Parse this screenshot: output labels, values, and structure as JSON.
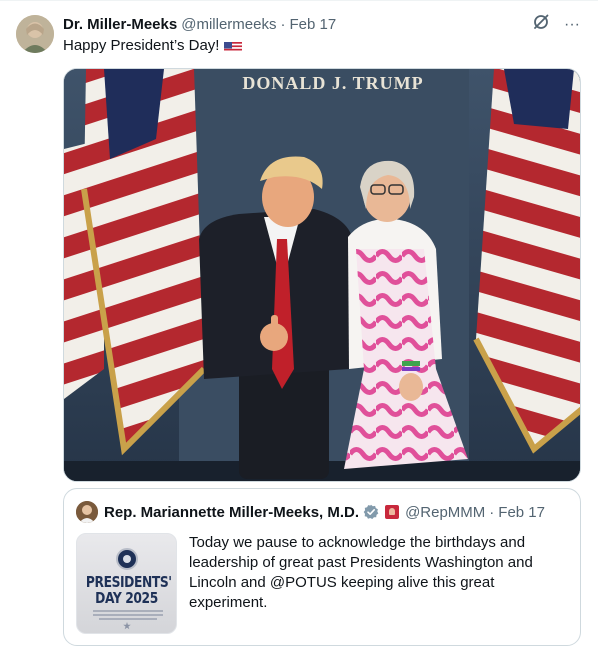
{
  "tweet": {
    "author_name": "Dr. Miller-Meeks",
    "author_handle": "@millermeeks",
    "separator": "·",
    "date": "Feb 17",
    "text": "Happy President’s Day!",
    "text_emoji": "us-flag-emoji",
    "tools": {
      "grok_icon": "grok-icon",
      "more_label": "···"
    }
  },
  "media": {
    "backdrop_text": "DONALD J. TRUMP",
    "alt": "photo",
    "colors": {
      "backdrop": "#3a4d62",
      "flag_red": "#b4282f",
      "flag_blue": "#1f2d5a",
      "flag_fringe": "#c9a14a",
      "dress_pink": "#e0509a"
    }
  },
  "quote": {
    "author_name": "Rep. Mariannette Miller-Meeks, M.D.",
    "verified_icon": "verified-gray-icon",
    "badge_icon": "government-badge-icon",
    "author_handle": "@RepMMM",
    "separator": "·",
    "date": "Feb 17",
    "text": "Today we pause to acknowledge the birthdays and leadership of great past Presidents Washington and Lincoln and @POTUS keeping alive this great experiment.",
    "thumbnail": {
      "title_line1": "PRESIDENTS'",
      "title_line2": "DAY 2025"
    }
  },
  "colors": {
    "text_primary": "#0f1419",
    "text_secondary": "#536471",
    "border": "#cfd9de",
    "verified_gray": "#829aab"
  }
}
